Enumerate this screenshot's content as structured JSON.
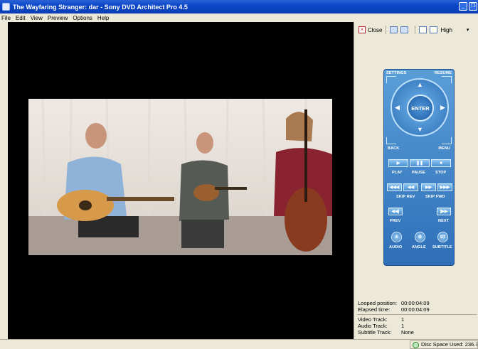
{
  "window": {
    "title": "The Wayfaring Stranger: dar - Sony DVD Architect Pro 4.5",
    "btn_minimize": "_",
    "btn_restore": "❐"
  },
  "menu": [
    "File",
    "Edit",
    "View",
    "Preview",
    "Options",
    "Help"
  ],
  "toolbar": {
    "close_label": "Close",
    "quality": "High",
    "quality_arrow": "▾"
  },
  "remote": {
    "settings": "SETTINGS",
    "resume": "RESUME",
    "enter": "ENTER",
    "back": "BACK",
    "menu": "MENU",
    "play": "PLAY",
    "pause": "PAUSE",
    "stop": "STOP",
    "skip_rev": "SKIP REV",
    "skip_fwd": "SKIP FWD",
    "prev": "PREV",
    "next": "NEXT",
    "audio": "AUDIO",
    "angle": "ANGLE",
    "subtitle": "SUBTITLE",
    "sym_play": "▶",
    "sym_pause": "❚❚",
    "sym_stop": "■",
    "sym_rew2": "◀◀◀",
    "sym_rew": "◀◀",
    "sym_fwd": "▶▶",
    "sym_fwd2": "▶▶▶",
    "sym_prev": "◀◀|",
    "sym_next": "|▶▶",
    "sym_audio": "A",
    "sym_angle": "Θ",
    "sym_subtitle": "ST",
    "arrow_up": "▲",
    "arrow_down": "▼",
    "arrow_left": "◀",
    "arrow_right": "▶"
  },
  "info": {
    "looped_position_label": "Looped position:",
    "looped_position": "00:00:04:09",
    "elapsed_time_label": "Elapsed time:",
    "elapsed_time": "00:00:04:09",
    "video_track_label": "Video Track:",
    "video_track": "1",
    "audio_track_label": "Audio Track:",
    "audio_track": "1",
    "subtitle_track_label": "Subtitle Track:",
    "subtitle_track": "None"
  },
  "status": {
    "disc_space": "Disc Space Used: 236.7MB"
  },
  "colors": {
    "titlebar": "#0a46c8",
    "remote": "#3b82c8",
    "viewer": "#000000"
  }
}
